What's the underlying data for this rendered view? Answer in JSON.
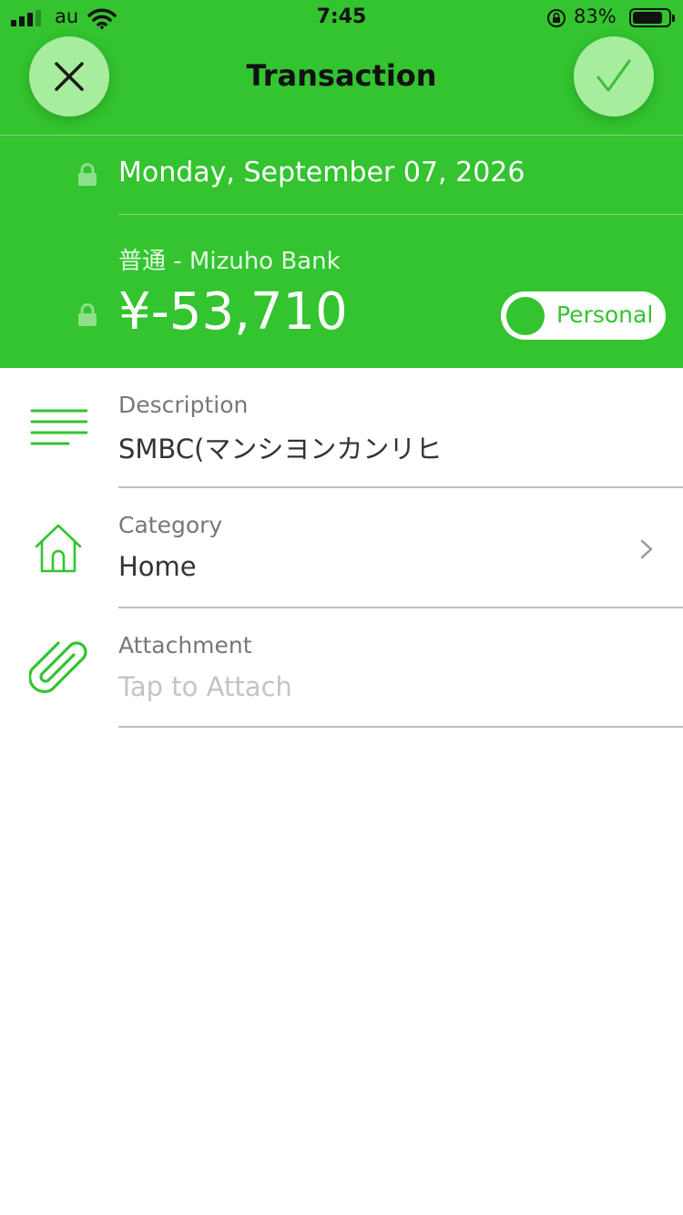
{
  "status_bar": {
    "carrier": "au",
    "time": "7:45",
    "battery_percent": "83%",
    "battery_level": 0.83,
    "signal_bars": 3
  },
  "nav": {
    "title": "Transaction",
    "close_icon": "close-icon",
    "confirm_icon": "checkmark-icon"
  },
  "transaction": {
    "date": "Monday, September 07, 2026",
    "account": "普通 - Mizuho Bank",
    "amount": "¥-53,710",
    "type_toggle_label": "Personal"
  },
  "fields": {
    "description": {
      "label": "Description",
      "value": "SMBC(マンシヨンカンリヒ"
    },
    "category": {
      "label": "Category",
      "value": "Home"
    },
    "attachment": {
      "label": "Attachment",
      "placeholder": "Tap to Attach"
    }
  },
  "colors": {
    "accent_green": "#33c42f",
    "button_light_green": "#a6ed9d",
    "white": "#ffffff"
  }
}
